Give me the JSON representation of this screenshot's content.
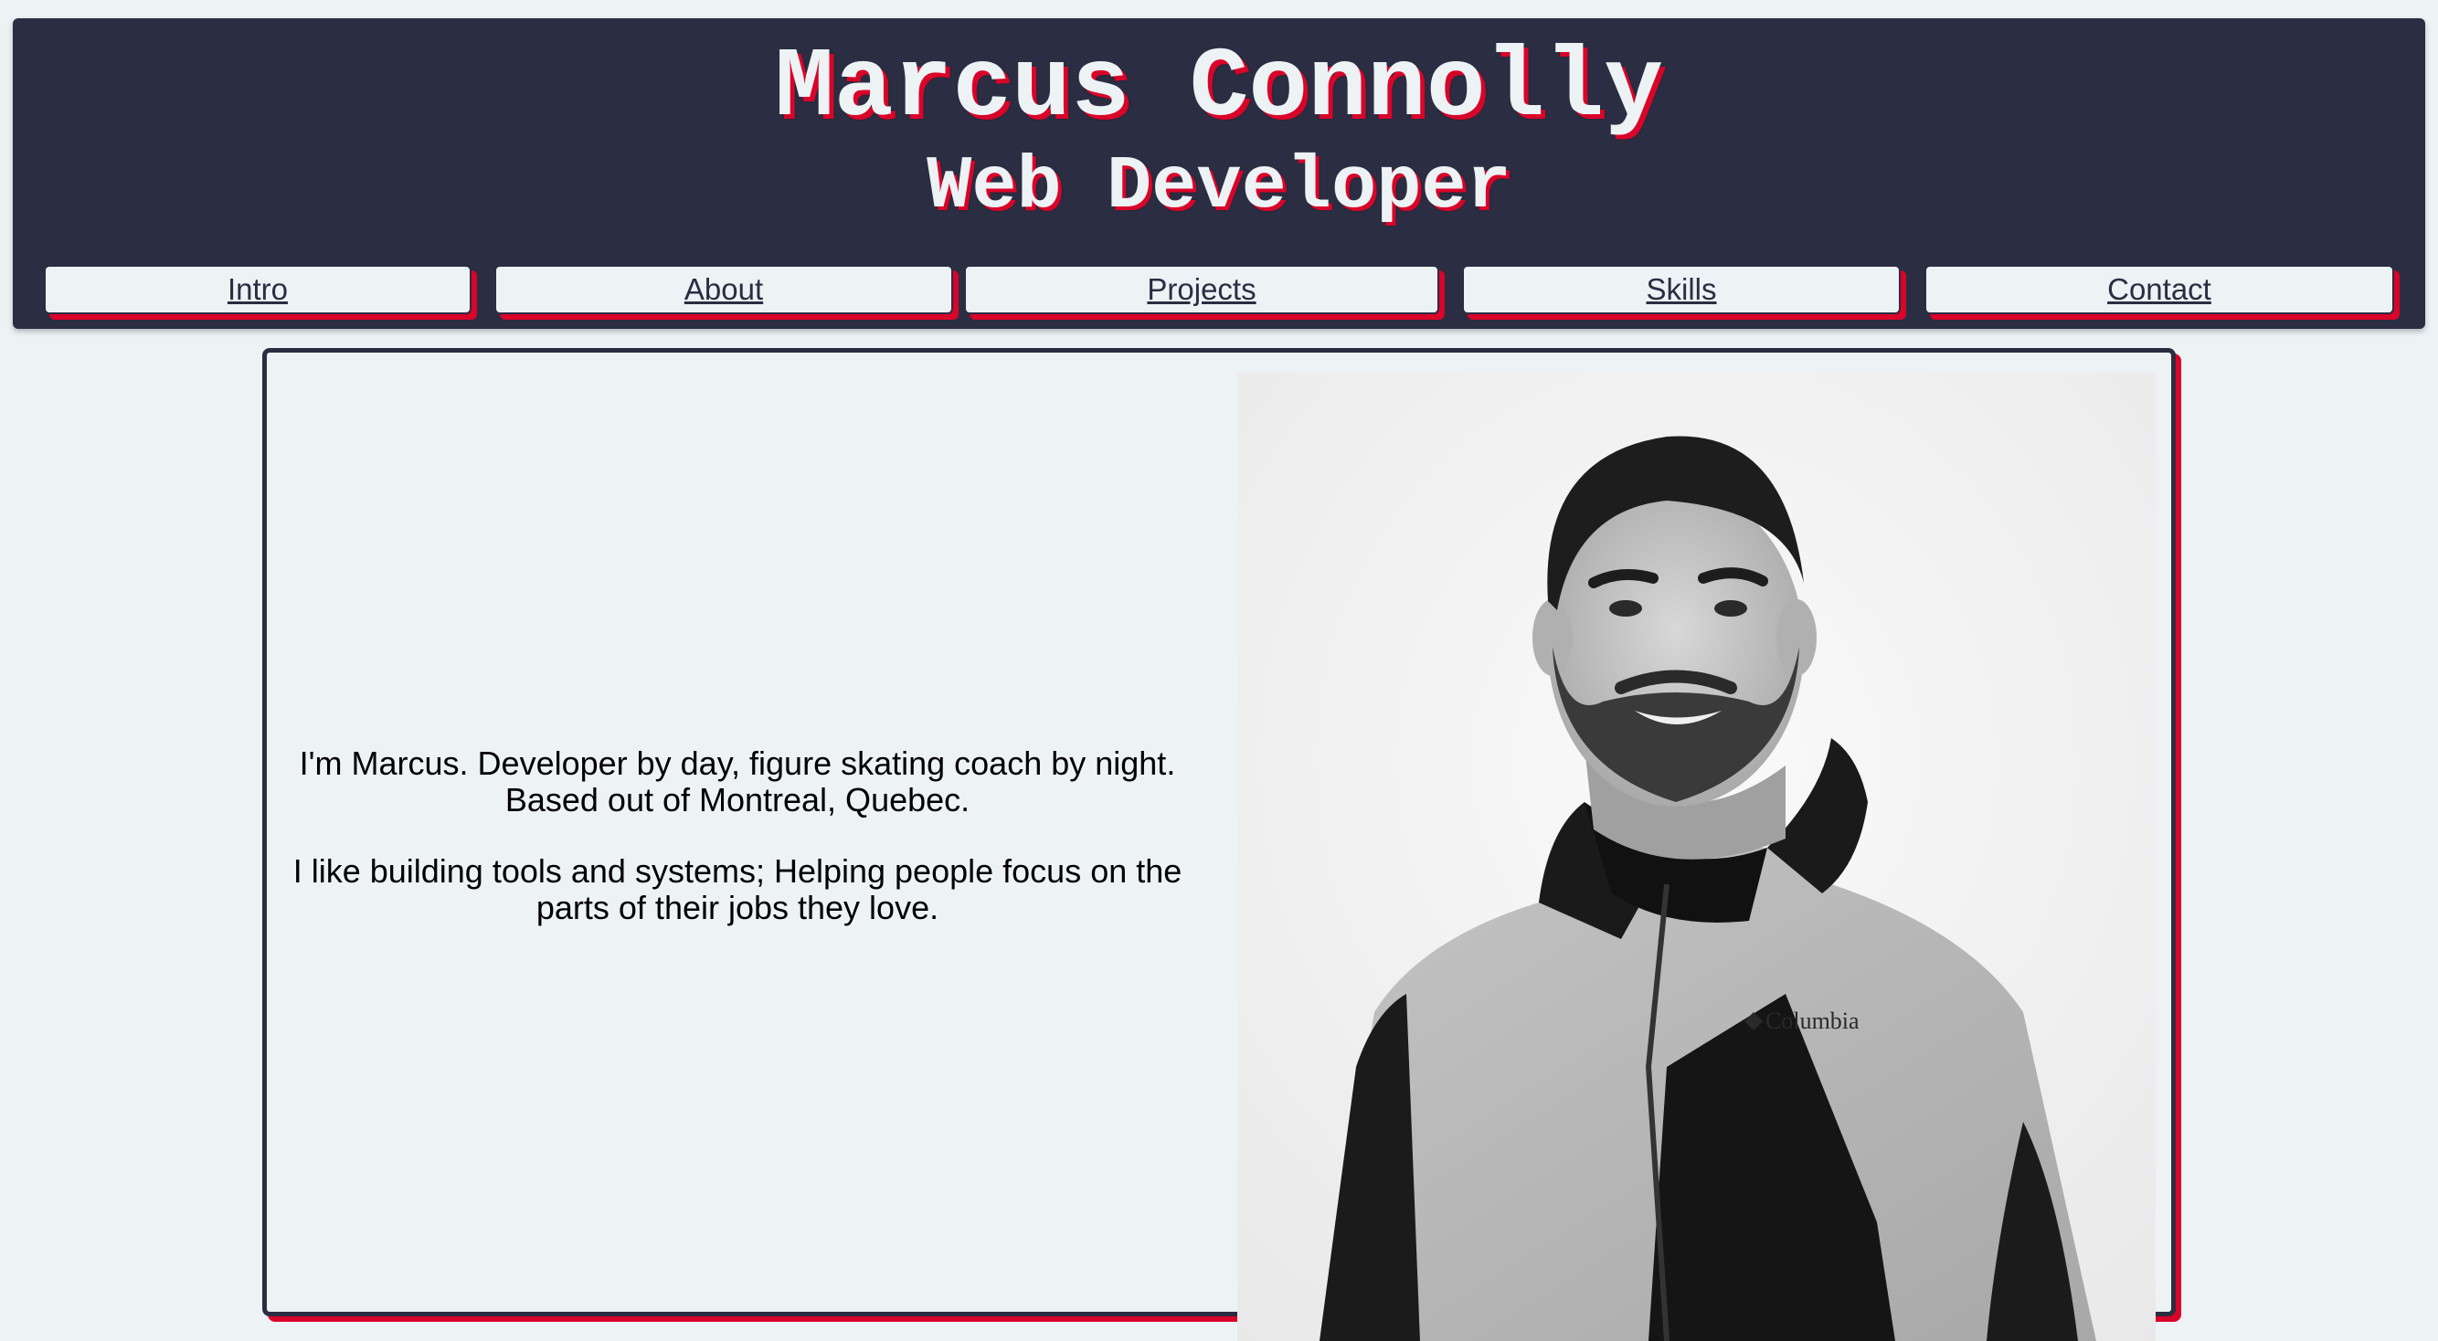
{
  "header": {
    "name": "Marcus Connolly",
    "role": "Web Developer"
  },
  "nav": {
    "items": [
      {
        "label": "Intro"
      },
      {
        "label": "About"
      },
      {
        "label": "Projects"
      },
      {
        "label": "Skills"
      },
      {
        "label": "Contact"
      }
    ]
  },
  "intro": {
    "paragraph1": "I'm Marcus. Developer by day, figure skating coach by night. Based out of Montreal, Quebec.",
    "paragraph2": "I like building tools and systems; Helping people focus on the parts of their jobs they love.",
    "photo": {
      "jacket_logo_text": "Columbia"
    }
  },
  "colors": {
    "dark": "#2b2d42",
    "light": "#edf2f5",
    "accent": "#d90429"
  }
}
